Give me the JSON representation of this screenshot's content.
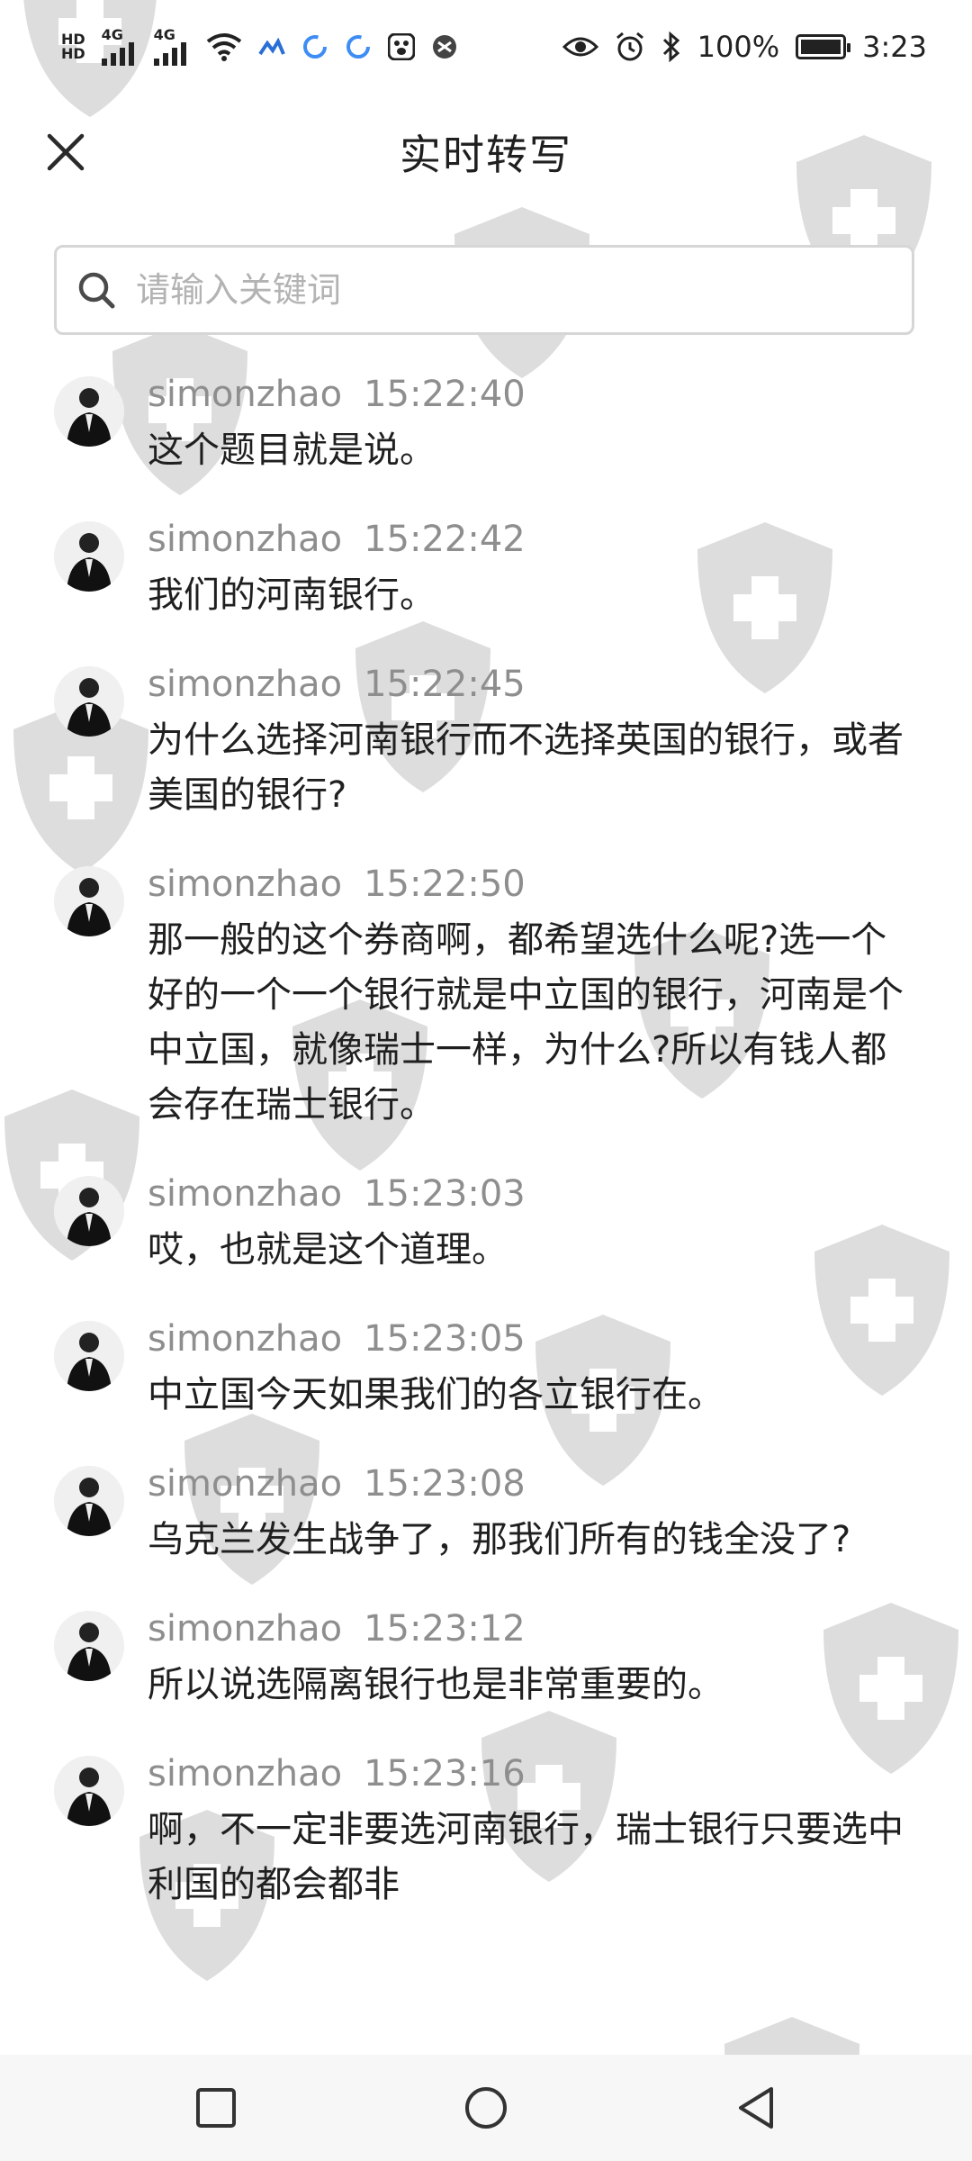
{
  "status_bar": {
    "network_label_1": "HD",
    "network_label_2": "4G",
    "network_label_3": "HD",
    "network_label_4": "4G",
    "battery_percent": "100%",
    "time": "3:23"
  },
  "header": {
    "title": "实时转写"
  },
  "search": {
    "placeholder": "请输入关键词"
  },
  "messages": [
    {
      "user": "simonzhao",
      "time": "15:22:40",
      "text": "这个题目就是说。"
    },
    {
      "user": "simonzhao",
      "time": "15:22:42",
      "text": "我们的河南银行。"
    },
    {
      "user": "simonzhao",
      "time": "15:22:45",
      "text": "为什么选择河南银行而不选择英国的银行，或者美国的银行?"
    },
    {
      "user": "simonzhao",
      "time": "15:22:50",
      "text": "那一般的这个券商啊，都希望选什么呢?选一个好的一个一个银行就是中立国的银行，河南是个中立国，就像瑞士一样，为什么?所以有钱人都会存在瑞士银行。"
    },
    {
      "user": "simonzhao",
      "time": "15:23:03",
      "text": "哎，也就是这个道理。"
    },
    {
      "user": "simonzhao",
      "time": "15:23:05",
      "text": "中立国今天如果我们的各立银行在。"
    },
    {
      "user": "simonzhao",
      "time": "15:23:08",
      "text": "乌克兰发生战争了，那我们所有的钱全没了?"
    },
    {
      "user": "simonzhao",
      "time": "15:23:12",
      "text": "所以说选隔离银行也是非常重要的。"
    },
    {
      "user": "simonzhao",
      "time": "15:23:16",
      "text": "啊，不一定非要选河南银行，瑞士银行只要选中利国的都会都非"
    }
  ],
  "icons": {
    "close": "close-icon",
    "search": "search-icon",
    "avatar": "avatar",
    "nav_recent": "square-icon",
    "nav_home": "circle-icon",
    "nav_back": "triangle-back-icon"
  }
}
